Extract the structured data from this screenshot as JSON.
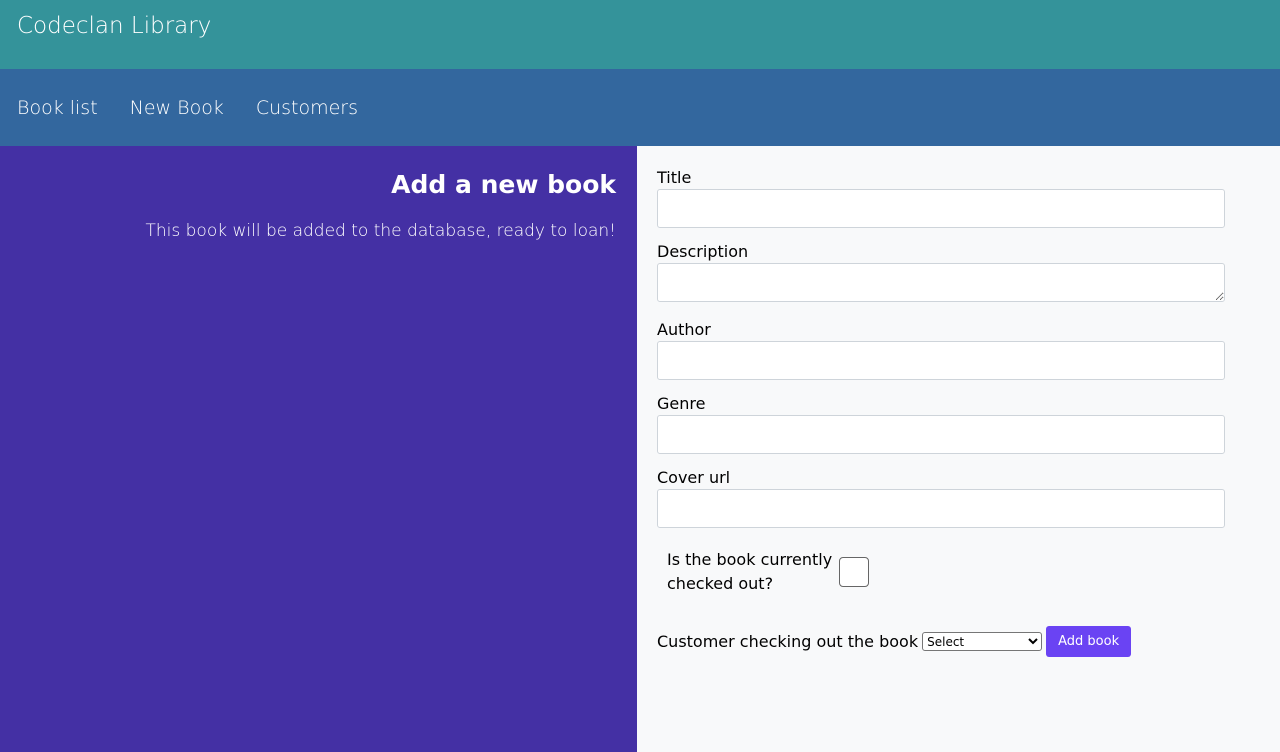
{
  "header": {
    "title": "Codeclan Library"
  },
  "nav": {
    "items": [
      {
        "label": "Book list"
      },
      {
        "label": "New Book"
      },
      {
        "label": "Customers"
      }
    ]
  },
  "intro": {
    "heading": "Add a new book",
    "text": "This book will be added to the database, ready to loan!"
  },
  "form": {
    "title_label": "Title",
    "title_value": "",
    "description_label": "Description",
    "description_value": "",
    "author_label": "Author",
    "author_value": "",
    "genre_label": "Genre",
    "genre_value": "",
    "cover_label": "Cover url",
    "cover_value": "",
    "checked_out_label": "Is the book currently checked out?",
    "checked_out_value": false,
    "customer_label": "Customer checking out the book",
    "customer_select": "Select",
    "submit_label": "Add book"
  },
  "colors": {
    "topbar": "#34939a",
    "navbar": "#33679e",
    "left_panel": "#4430a4",
    "button": "#6a43f3"
  }
}
